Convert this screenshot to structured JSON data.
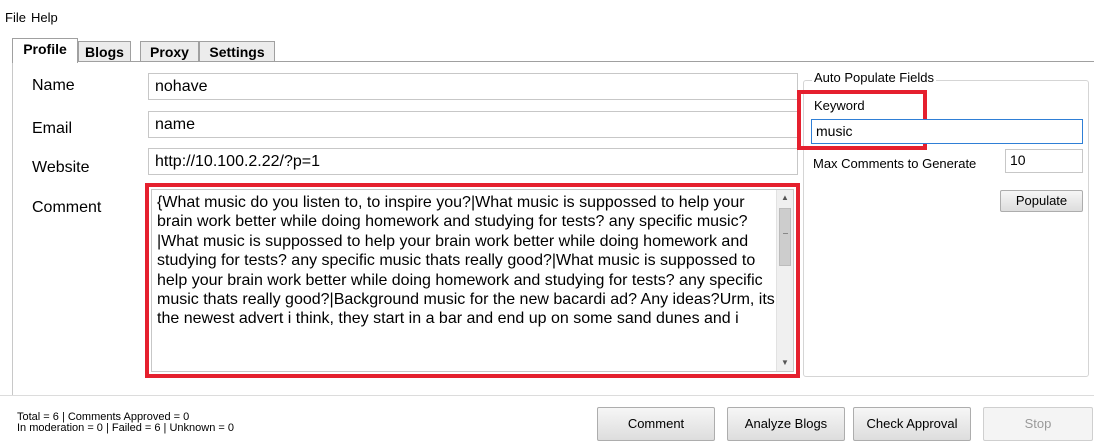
{
  "menu": {
    "file": "File",
    "help": "Help"
  },
  "tabs": [
    {
      "label": "Profile",
      "active": true
    },
    {
      "label": "Blogs"
    },
    {
      "label": "Proxy"
    },
    {
      "label": "Settings"
    }
  ],
  "profile": {
    "name_label": "Name",
    "name_value": "nohave",
    "email_label": "Email",
    "email_value": "name",
    "website_label": "Website",
    "website_value": "http://10.100.2.22/?p=1",
    "comment_label": "Comment",
    "comment_value": "{What music do you listen to, to inspire you?|What music is suppossed to help your brain work better while doing homework and studying for tests? any specific music?|What music is suppossed to help your brain work better while doing homework and studying for tests? any specific music thats really good?|What music is suppossed to help your brain work better while doing homework and studying for tests? any specific music thats really good?|Background music for the new bacardi ad? Any ideas?Urm, its the newest advert i think, they start in a bar and end up on some sand dunes and i"
  },
  "auto_populate": {
    "title": "Auto Populate Fields",
    "keyword_label": "Keyword",
    "keyword_value": "music",
    "max_label": "Max Comments to Generate",
    "max_value": "10",
    "populate_button": "Populate"
  },
  "status": {
    "line1": "Total = 6 | Comments Approved = 0",
    "line2": "In moderation = 0 | Failed = 6 | Unknown = 0"
  },
  "actions": {
    "comment": "Comment",
    "analyze": "Analyze Blogs",
    "check": "Check Approval",
    "stop": "Stop"
  },
  "colors": {
    "highlight": "#e5202e",
    "focus_border": "#2f7fd6"
  }
}
